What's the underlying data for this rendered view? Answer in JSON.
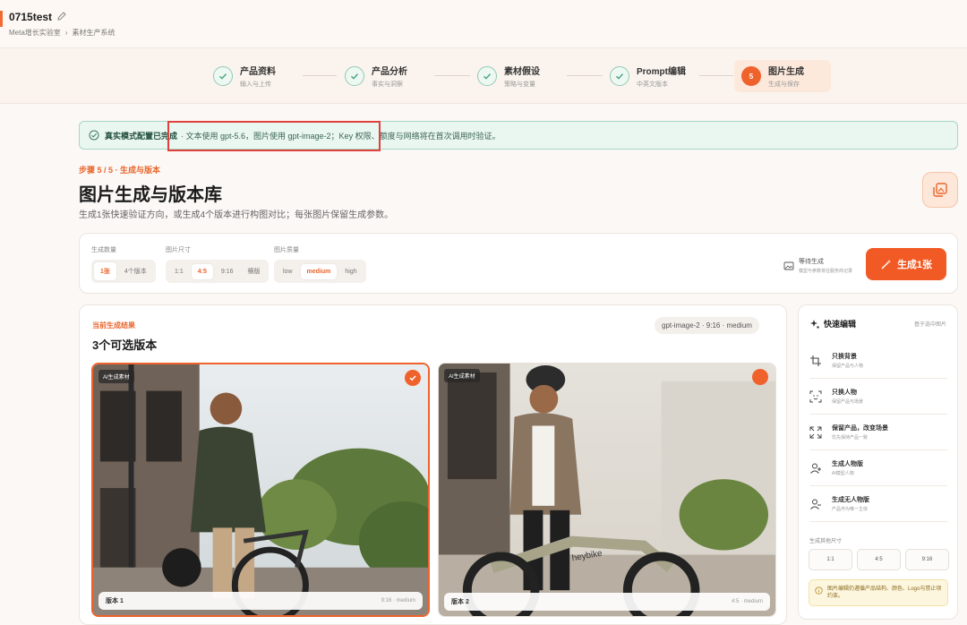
{
  "header": {
    "project_title": "0715test",
    "breadcrumb": [
      "Meta增长实验室",
      "素材生产系统"
    ]
  },
  "steps": [
    {
      "title": "产品资料",
      "subtitle": "输入与上传",
      "state": "done"
    },
    {
      "title": "产品分析",
      "subtitle": "事实与洞察",
      "state": "done"
    },
    {
      "title": "素材假设",
      "subtitle": "策略与变量",
      "state": "done"
    },
    {
      "title": "Prompt编辑",
      "subtitle": "中英文版本",
      "state": "done"
    },
    {
      "title": "图片生成",
      "subtitle": "生成与保存",
      "state": "active",
      "number": "5"
    }
  ],
  "banner": {
    "bold": "真实模式配置已完成",
    "text": "· 文本使用 gpt-5.6，图片使用 gpt-image-2；Key 权限、额度与网络将在首次调用时验证。"
  },
  "page": {
    "step_label": "步骤 5 / 5 · 生成与版本",
    "title": "图片生成与版本库",
    "description": "生成1张快速验证方向，或生成4个版本进行构图对比；每张图片保留生成参数。"
  },
  "controls": {
    "count_label": "生成数量",
    "count_options": [
      "1张",
      "4个版本"
    ],
    "count_selected": "1张",
    "size_label": "图片尺寸",
    "size_options": [
      "1:1",
      "4:5",
      "9:16",
      "横版"
    ],
    "size_selected": "4:5",
    "quality_label": "图片质量",
    "quality_options": [
      "low",
      "medium",
      "high"
    ],
    "quality_selected": "medium",
    "wait_title": "等待生成",
    "wait_sub": "模型与参数将在服务商记录",
    "generate_button": "生成1张"
  },
  "results": {
    "label": "当前生成结果",
    "title": "3个可选版本",
    "meta": "gpt-image-2 · 9:16 · medium",
    "cards": [
      {
        "tag": "AI生成素材",
        "version": "版本 1",
        "meta": "9:16 · medium",
        "selected": true
      },
      {
        "tag": "AI生成素材",
        "version": "版本 2",
        "meta": "4:5 · medium",
        "selected": false
      }
    ],
    "bike_brand": "heybike"
  },
  "side": {
    "title": "快速编辑",
    "hint": "基于选中图片",
    "items": [
      {
        "title": "只换背景",
        "sub": "保留产品与人物",
        "icon": "crop-icon"
      },
      {
        "title": "只换人物",
        "sub": "保留产品与场景",
        "icon": "face-scan-icon"
      },
      {
        "title": "保留产品，改变场景",
        "sub": "优先保持产品一致",
        "icon": "expand-icon"
      },
      {
        "title": "生成人物版",
        "sub": "AI模型人物",
        "icon": "user-add-icon"
      },
      {
        "title": "生成无人物版",
        "sub": "产品作为唯一主体",
        "icon": "user-remove-icon"
      }
    ],
    "size_label": "生成其他尺寸",
    "sizes": [
      "1:1",
      "4:5",
      "9:16"
    ],
    "note": "图片编辑仍遵循产品结构、颜色、Logo与禁止项约束。"
  },
  "colors": {
    "accent": "#f0622c",
    "success": "#8fcab5",
    "banner_bg": "#eaf6f0"
  }
}
